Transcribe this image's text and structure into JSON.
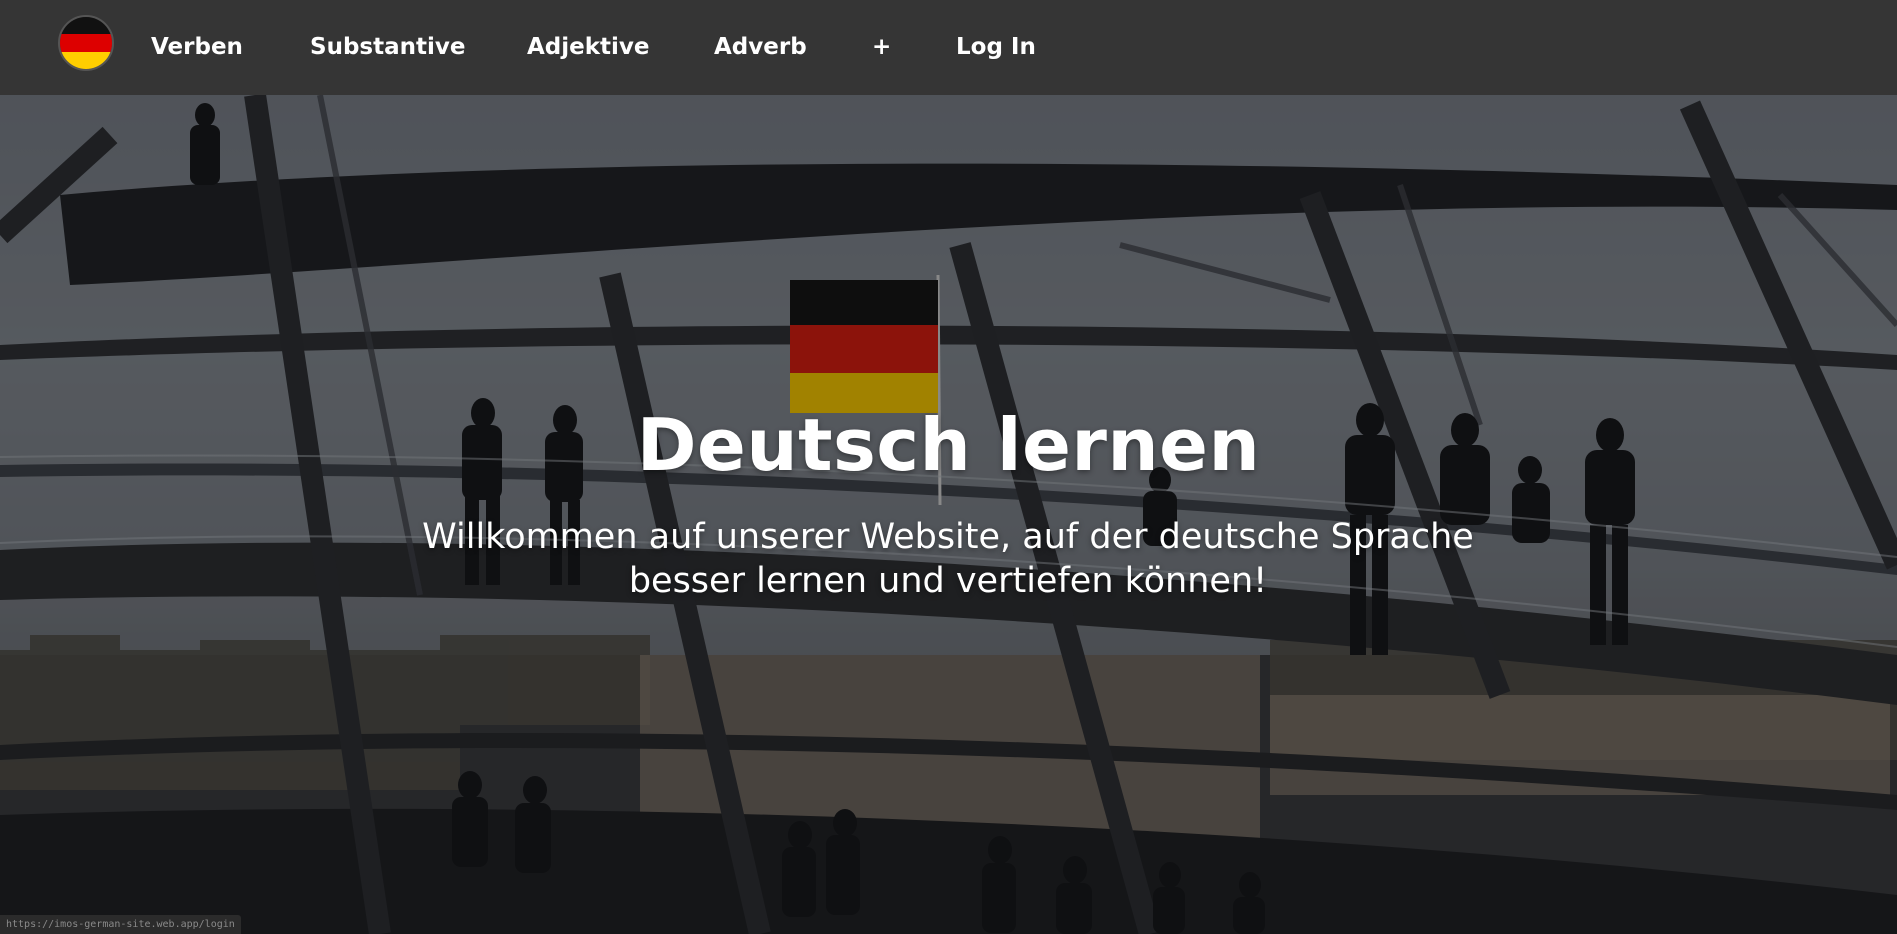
{
  "nav": {
    "logo_icon": "german-flag-icon",
    "items": [
      {
        "label": "Verben"
      },
      {
        "label": "Substantive"
      },
      {
        "label": "Adjektive"
      },
      {
        "label": "Adverb"
      },
      {
        "label": "+"
      },
      {
        "label": "Log In"
      }
    ]
  },
  "hero": {
    "title": "Deutsch lernen",
    "subtitle_line1": "Willkommen auf unserer Website, auf der deutsche Sprache",
    "subtitle_line2": "besser lernen und vertiefen können!",
    "background_icon": "reichstag-dome-photo"
  },
  "status_bar": {
    "url": "https://imos-german-site.web.app/login"
  },
  "colors": {
    "navbar_bg": "#353535",
    "text": "#ffffff",
    "flag_black": "#000000",
    "flag_red": "#dd0000",
    "flag_gold": "#ffce00"
  }
}
